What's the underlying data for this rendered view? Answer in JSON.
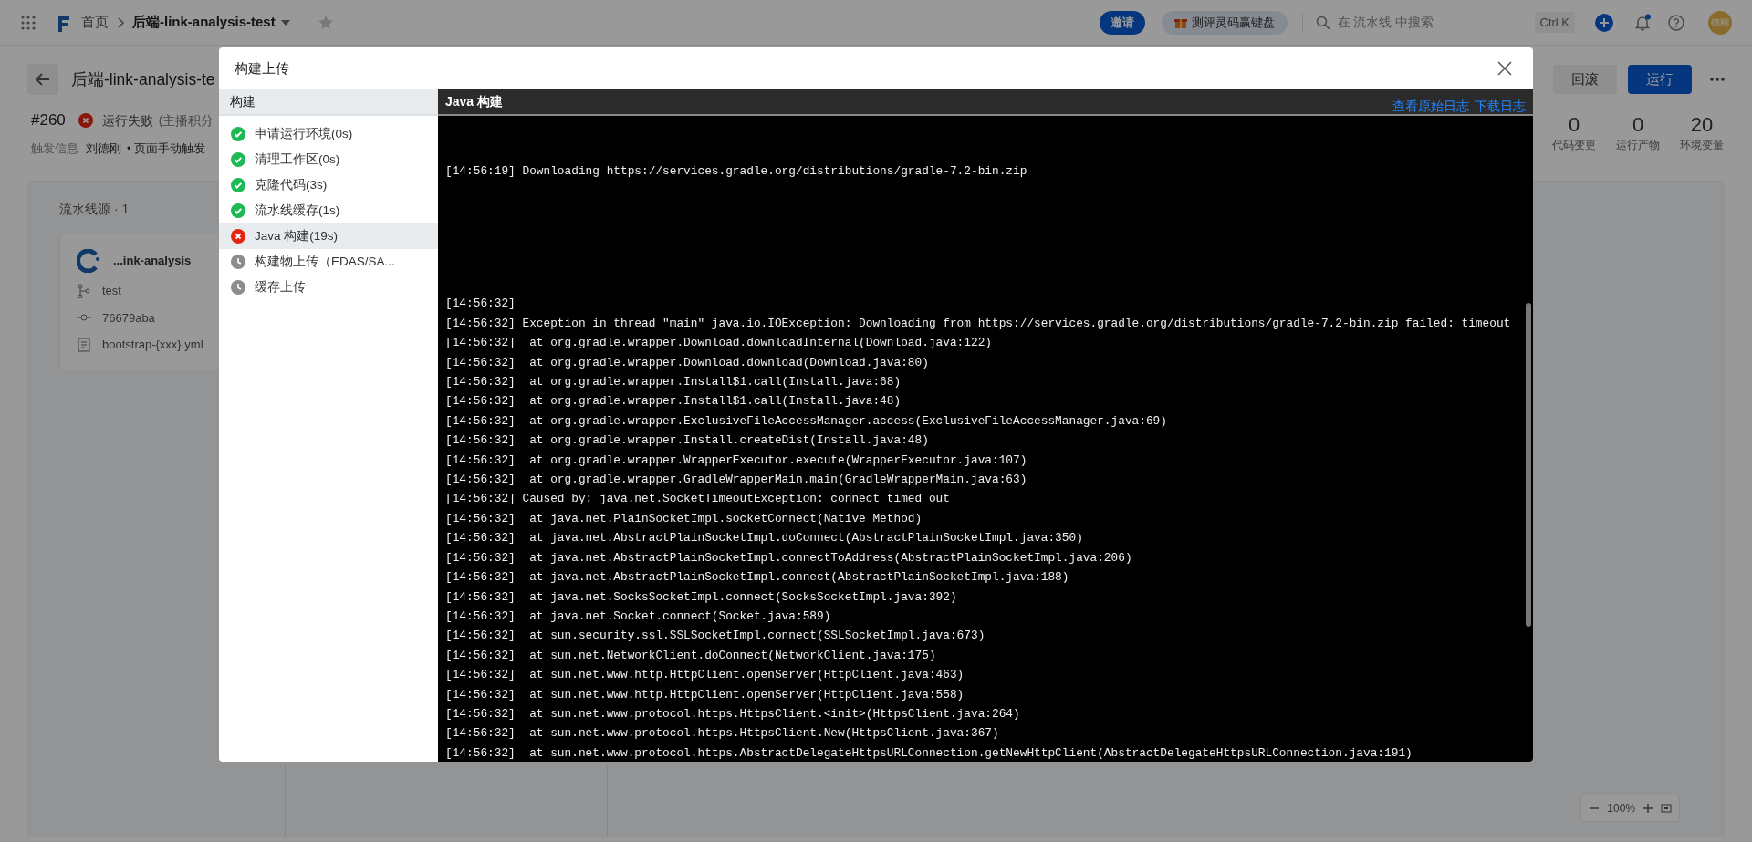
{
  "top_nav": {
    "home": "首页",
    "project": "后端-link-analysis-test",
    "invite_button": "邀请",
    "promo": "测评灵码赢键盘",
    "search": {
      "placeholder": "在 流水线 中搜索"
    },
    "shortcut": "Ctrl K",
    "avatar": "德刚"
  },
  "header": {
    "title": "后端-link-analysis-te",
    "buttons": [
      {
        "label": "回滚",
        "kind": "secondary"
      },
      {
        "label": "运行",
        "kind": "primary"
      }
    ]
  },
  "run": {
    "number": "#260",
    "status": "运行失败",
    "kind": "failed",
    "note": "(主播积分",
    "trigger_label": "触发信息",
    "trigger_user": "刘德刚",
    "trigger_method": "• 页面手动触发"
  },
  "stats": [
    {
      "value": "0",
      "label": "代码变更"
    },
    {
      "value": "0",
      "label": "运行产物"
    },
    {
      "value": "20",
      "label": "环境变量"
    }
  ],
  "sources": {
    "title": "流水线源 · 1",
    "card": {
      "name": "...ink-analysis",
      "branch": "test",
      "commit": "76679aba",
      "file": "bootstrap-{xxx}.yml"
    }
  },
  "zoom_control": {
    "value": "100%"
  },
  "modal": {
    "title": "构建上传",
    "stage": "构建",
    "steps": [
      {
        "label": "申请运行环境(0s)",
        "kind": "success",
        "selected": false
      },
      {
        "label": "清理工作区(0s)",
        "kind": "success",
        "selected": false
      },
      {
        "label": "克隆代码(3s)",
        "kind": "success",
        "selected": false
      },
      {
        "label": "流水线缓存(1s)",
        "kind": "success",
        "selected": false
      },
      {
        "label": "Java 构建(19s)",
        "kind": "failed",
        "selected": true
      },
      {
        "label": "构建物上传（EDAS/SA...",
        "kind": "pending",
        "selected": false
      },
      {
        "label": "缓存上传",
        "kind": "pending",
        "selected": false
      }
    ],
    "log": {
      "title": "Java 构建",
      "links": [
        "查看原始日志",
        "下载日志"
      ],
      "groups": [
        [
          "[14:56:19] Downloading https://services.gradle.org/distributions/gradle-7.2-bin.zip"
        ],
        [
          "[14:56:32]",
          "[14:56:32] Exception in thread \"main\" java.io.IOException: Downloading from https://services.gradle.org/distributions/gradle-7.2-bin.zip failed: timeout",
          "[14:56:32]  at org.gradle.wrapper.Download.downloadInternal(Download.java:122)",
          "[14:56:32]  at org.gradle.wrapper.Download.download(Download.java:80)",
          "[14:56:32]  at org.gradle.wrapper.Install$1.call(Install.java:68)",
          "[14:56:32]  at org.gradle.wrapper.Install$1.call(Install.java:48)",
          "[14:56:32]  at org.gradle.wrapper.ExclusiveFileAccessManager.access(ExclusiveFileAccessManager.java:69)",
          "[14:56:32]  at org.gradle.wrapper.Install.createDist(Install.java:48)",
          "[14:56:32]  at org.gradle.wrapper.WrapperExecutor.execute(WrapperExecutor.java:107)",
          "[14:56:32]  at org.gradle.wrapper.GradleWrapperMain.main(GradleWrapperMain.java:63)",
          "[14:56:32] Caused by: java.net.SocketTimeoutException: connect timed out",
          "[14:56:32]  at java.net.PlainSocketImpl.socketConnect(Native Method)",
          "[14:56:32]  at java.net.AbstractPlainSocketImpl.doConnect(AbstractPlainSocketImpl.java:350)",
          "[14:56:32]  at java.net.AbstractPlainSocketImpl.connectToAddress(AbstractPlainSocketImpl.java:206)",
          "[14:56:32]  at java.net.AbstractPlainSocketImpl.connect(AbstractPlainSocketImpl.java:188)",
          "[14:56:32]  at java.net.SocksSocketImpl.connect(SocksSocketImpl.java:392)",
          "[14:56:32]  at java.net.Socket.connect(Socket.java:589)",
          "[14:56:32]  at sun.security.ssl.SSLSocketImpl.connect(SSLSocketImpl.java:673)",
          "[14:56:32]  at sun.net.NetworkClient.doConnect(NetworkClient.java:175)",
          "[14:56:32]  at sun.net.www.http.HttpClient.openServer(HttpClient.java:463)",
          "[14:56:32]  at sun.net.www.http.HttpClient.openServer(HttpClient.java:558)",
          "[14:56:32]  at sun.net.www.protocol.https.HttpsClient.<init>(HttpsClient.java:264)",
          "[14:56:32]  at sun.net.www.protocol.https.HttpsClient.New(HttpsClient.java:367)",
          "[14:56:32]  at sun.net.www.protocol.https.AbstractDelegateHttpsURLConnection.getNewHttpClient(AbstractDelegateHttpsURLConnection.java:191)"
        ]
      ]
    }
  }
}
